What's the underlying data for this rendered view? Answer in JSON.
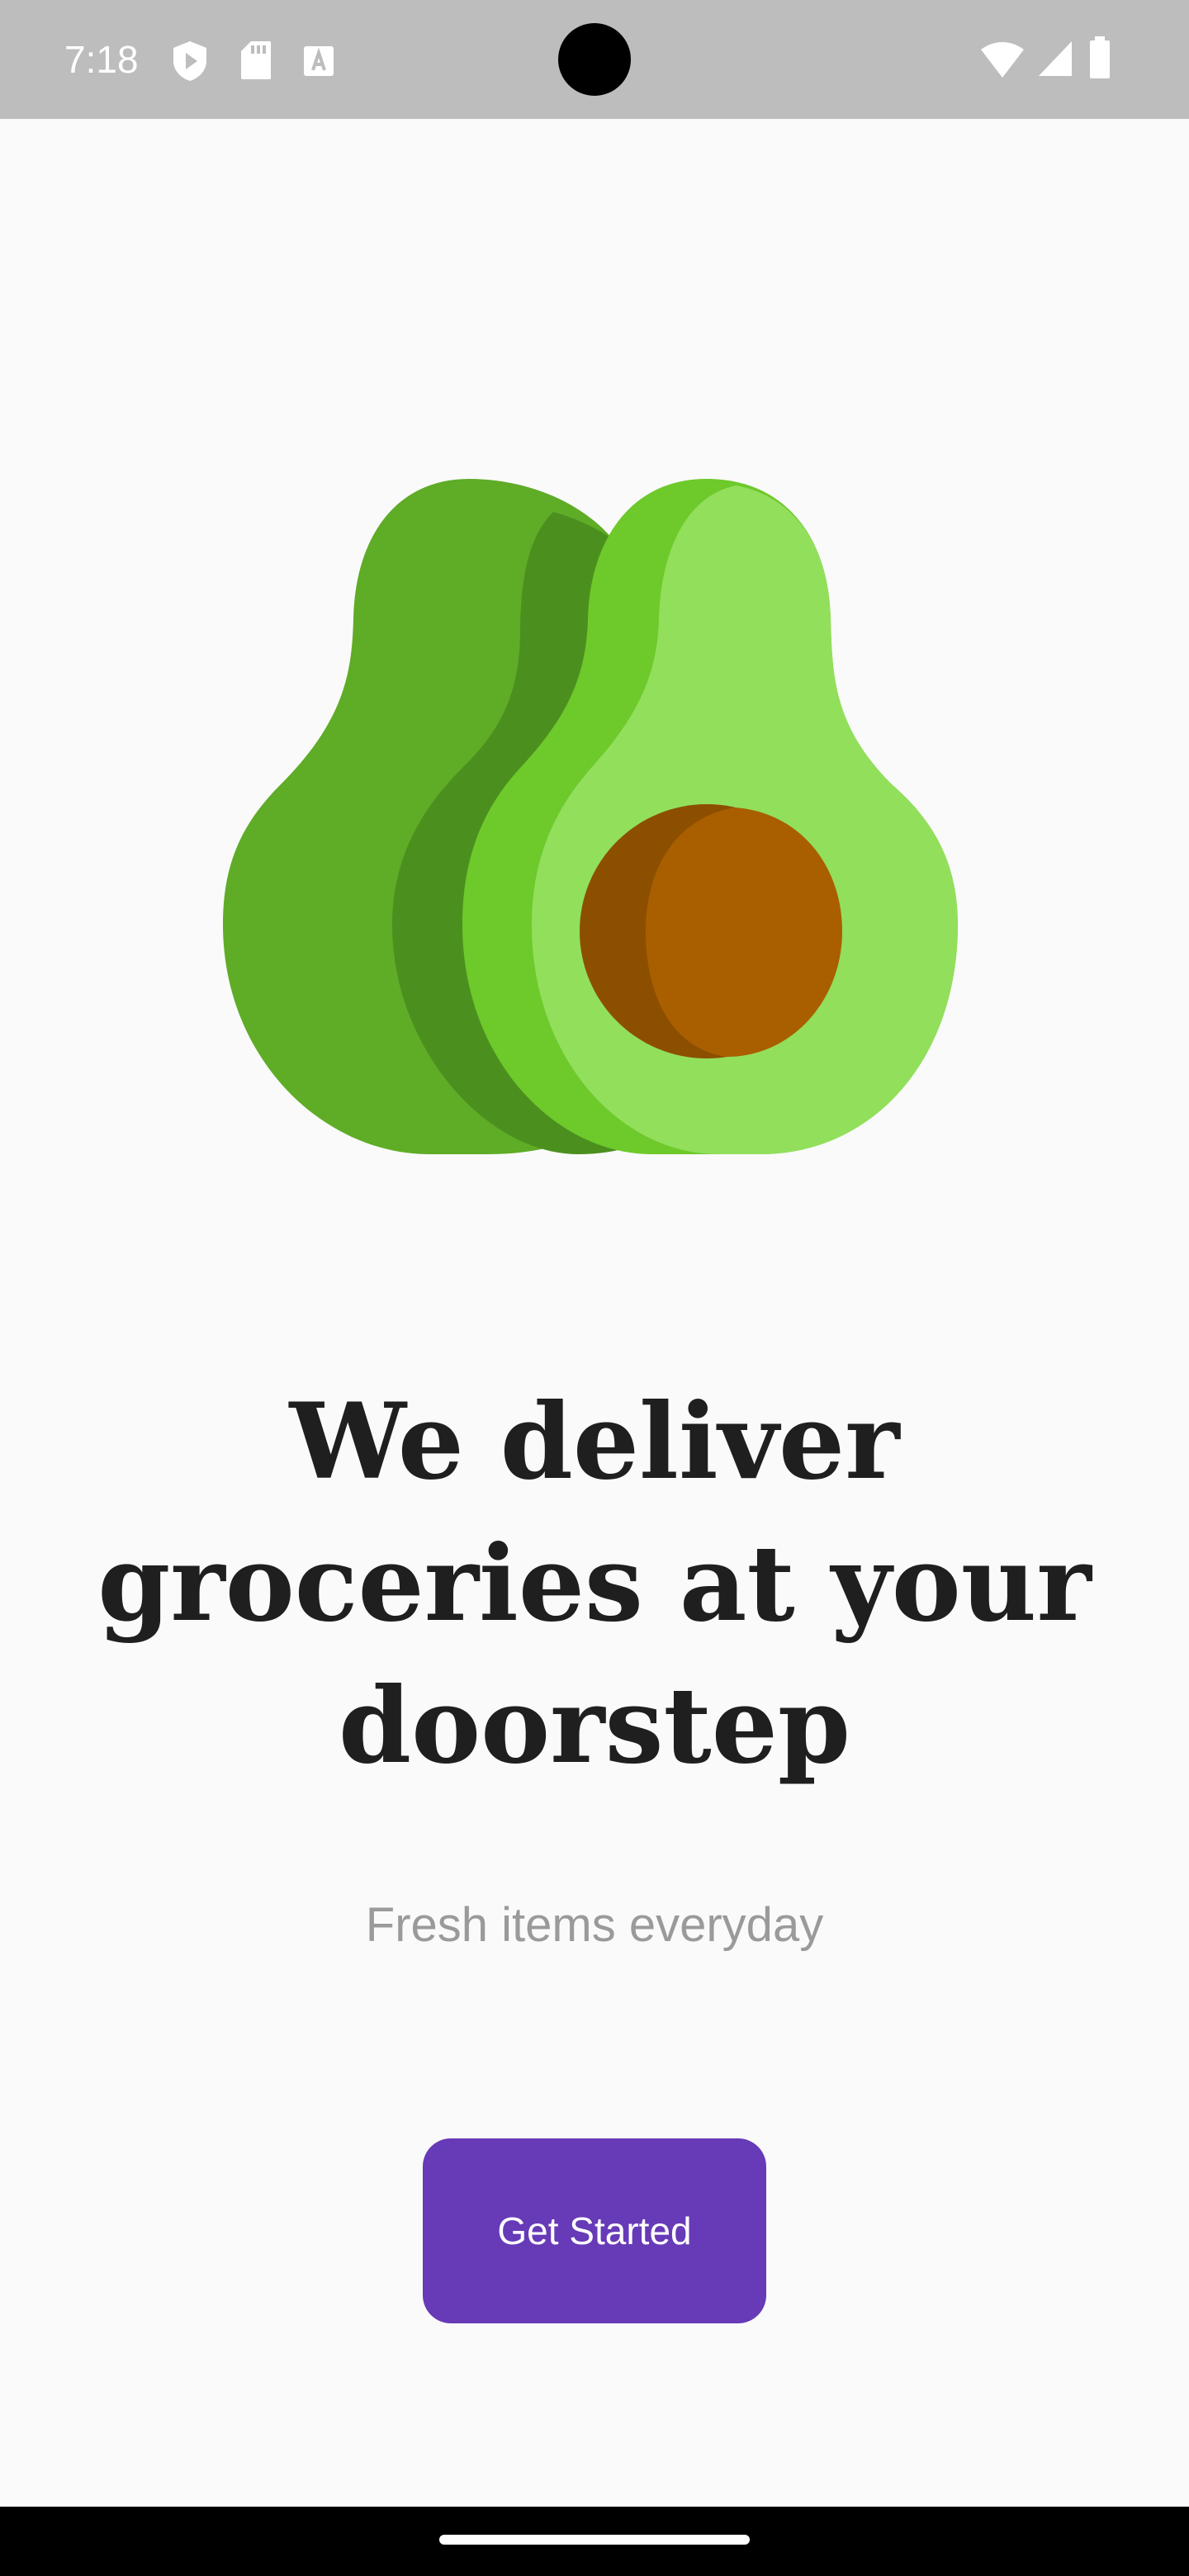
{
  "status_bar": {
    "time": "7:18",
    "icons": [
      "play-protect-icon",
      "sd-card-icon",
      "font-a-icon",
      "wifi-icon",
      "signal-icon",
      "battery-icon"
    ]
  },
  "hero": {
    "illustration": "avocado-illustration"
  },
  "onboarding": {
    "headline": "We deliver groceries at your doorstep",
    "subtitle": "Fresh items everyday",
    "cta_label": "Get Started"
  },
  "colors": {
    "accent": "#673ab7",
    "avocado_dark": "#5fac27",
    "avocado_light": "#92df5c",
    "pit": "#a95f00"
  }
}
